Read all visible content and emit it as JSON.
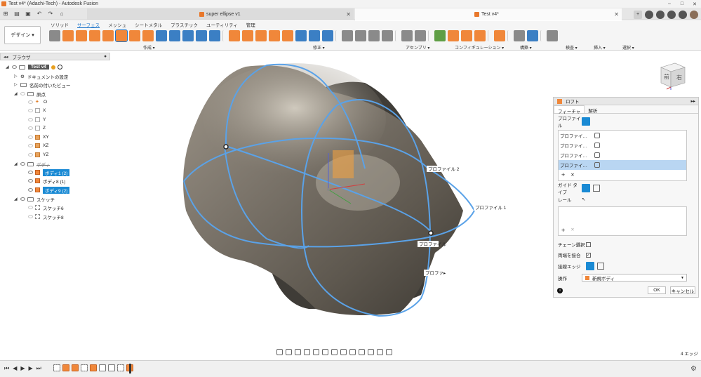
{
  "window": {
    "title": "Test v4* (Adachi-Tech) - Autodesk Fusion",
    "minimize": "–",
    "maximize": "□",
    "close": "✕"
  },
  "tabs": [
    {
      "label": "super ellipse v1",
      "close": "✕"
    },
    {
      "label": "Test v4*",
      "close": "✕"
    }
  ],
  "workspace": {
    "label": "デザイン ▾"
  },
  "ribbon": {
    "tabs": [
      "ソリッド",
      "サーフェス",
      "メッシュ",
      "シートメタル",
      "プラスチック",
      "ユーティリティ",
      "管理"
    ],
    "groups": [
      "作成 ▾",
      "修正 ▾",
      "アセンブリ ▾",
      "コンフィギュレーション ▾",
      "構築 ▾",
      "検査 ▾",
      "挿入 ▾",
      "選択 ▾"
    ]
  },
  "browser": {
    "title": "ブラウザ",
    "root": "Test v4",
    "items": {
      "doc_settings": "ドキュメントの設定",
      "named_views": "名前の付いたビュー",
      "origin": "原点",
      "origin_o": "O",
      "origin_x": "X",
      "origin_y": "Y",
      "origin_z": "Z",
      "origin_xy": "XY",
      "origin_xz": "XZ",
      "origin_yz": "YZ",
      "bodies": "ボディ",
      "body1": "ボディ1 (2)",
      "body8": "ボディ8 (1)",
      "body9": "ボディ9 (2)",
      "sketches": "スケッチ",
      "sketch6": "スケッチ6",
      "sketch8": "スケッチ8"
    }
  },
  "viewport": {
    "labels": {
      "p2": "プロファイル 2",
      "p1": "プロファイル 1",
      "p3": "プロファイル",
      "p4": "プロファ▸"
    }
  },
  "viewcube": {
    "front": "前",
    "right": "右"
  },
  "loft": {
    "title": "ロフト",
    "tabs": [
      "フィーチャ",
      "解析"
    ],
    "profile_label": "プロファイル",
    "profiles": [
      "プロファイ…",
      "プロファイ…",
      "プロファイ…",
      "プロファイ…"
    ],
    "add": "+",
    "remove": "✕",
    "guide_type_label": "ガイド タイプ",
    "rail_label": "レール",
    "chain_label": "チェーン選択",
    "closed_label": "両端を接合",
    "tangent_label": "接線エッジ",
    "operation_label": "操作",
    "operation_value": "新規ボディ",
    "ok": "OK",
    "cancel": "キャンセル",
    "info": "i"
  },
  "status": {
    "text": "4 エッジ"
  }
}
